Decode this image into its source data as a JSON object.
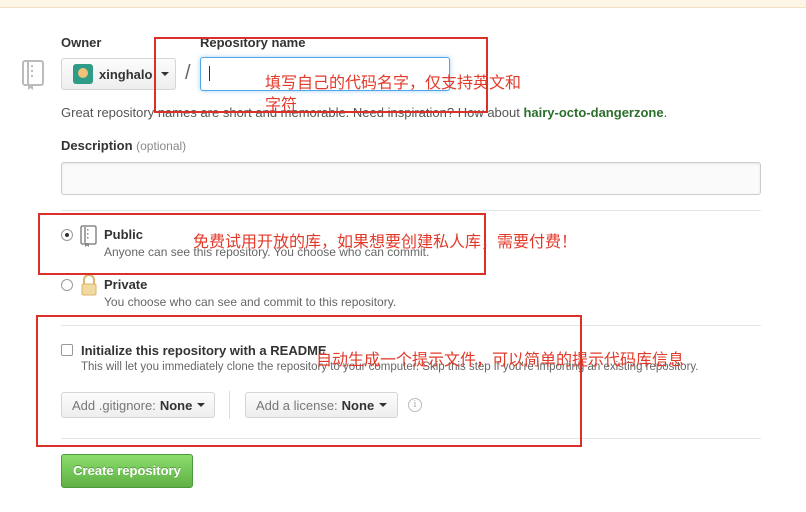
{
  "owner": {
    "label": "Owner",
    "name": "xinghalo"
  },
  "repository_name": {
    "label": "Repository name",
    "value": ""
  },
  "separator": "/",
  "hint": {
    "prefix": "Great repository names are short and memorable. Need inspiration? How about ",
    "suggestion": "hairy-octo-dangerzone",
    "suffix": "."
  },
  "description": {
    "label": "Description",
    "optional": "(optional)",
    "value": ""
  },
  "visibility": {
    "public": {
      "title": "Public",
      "desc": "Anyone can see this repository. You choose who can commit.",
      "selected": true
    },
    "private": {
      "title": "Private",
      "desc": "You choose who can see and commit to this repository.",
      "selected": false
    }
  },
  "init": {
    "title": "Initialize this repository with a README",
    "desc": "This will let you immediately clone the repository to your computer. Skip this step if you're importing an existing repository.",
    "checked": false
  },
  "gitignore": {
    "label": "Add .gitignore:",
    "value": "None"
  },
  "license": {
    "label": "Add a license:",
    "value": "None"
  },
  "info_glyph": "i",
  "create_button": "Create repository",
  "annotations": {
    "name_note_line1": "填写自己的代码名字，仅支持英文和",
    "name_note_line2": "字符",
    "public_note": "免费试用开放的库，如果想要创建私人库，需要付费！",
    "readme_note": "自动生成一个提示文件，可以简单的提示代码库信息"
  },
  "colors": {
    "primary_button": "#60b044",
    "annotation": "#d9302a",
    "link_green": "#2c6e2c"
  }
}
